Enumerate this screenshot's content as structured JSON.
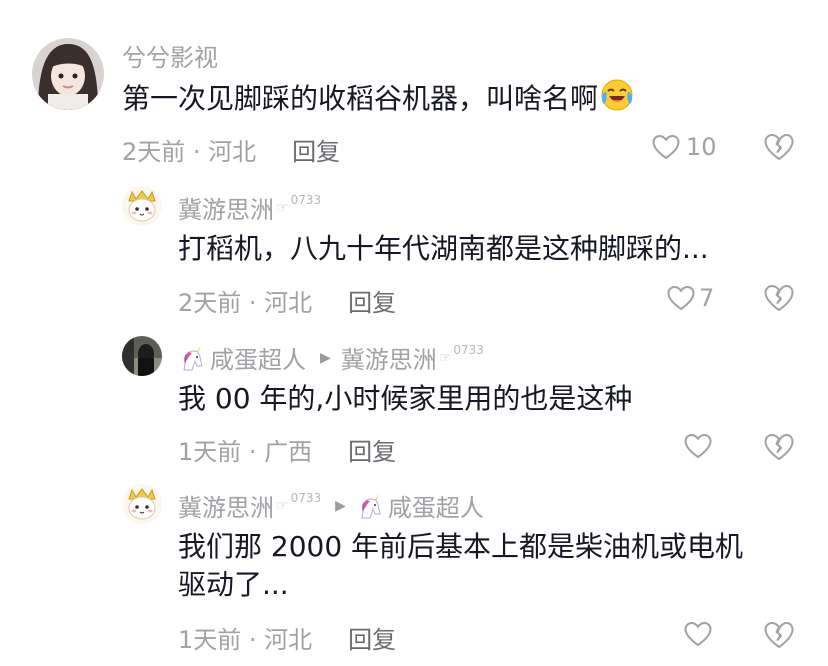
{
  "comments": [
    {
      "username": "兮兮影视",
      "text": "第一次见脚踩的收稻谷机器，叫啥名啊",
      "time_location": "2天前 · 河北",
      "reply_label": "回复",
      "likes": "10"
    },
    {
      "username": "冀游思洲",
      "user_tag": "0733",
      "text": "打稻机，八九十年代湖南都是这种脚踩的...",
      "time_location": "2天前 · 河北",
      "reply_label": "回复",
      "likes": "7"
    },
    {
      "username": "咸蛋超人",
      "reply_to": "冀游思洲",
      "reply_to_tag": "0733",
      "text": "我 00 年的,小时候家里用的也是这种",
      "time_location": "1天前 · 广西",
      "reply_label": "回复",
      "likes": ""
    },
    {
      "username": "冀游思洲",
      "user_tag": "0733",
      "reply_to": "咸蛋超人",
      "text_line1": "我们那 2000 年前后基本上都是柴油机或电机",
      "text_line2": "驱动了...",
      "time_location": "1天前 · 河北",
      "reply_label": "回复",
      "likes": ""
    }
  ],
  "icons": {
    "like": "heart-outline-icon",
    "dislike": "broken-heart-icon",
    "emoji": "laughing-tears-emoji",
    "reply_arrow": "triangle-right-icon",
    "pointing_hand": "pointing-hand-icon"
  },
  "colors": {
    "primary_text": "#161823",
    "secondary_text": "#a1a1a6",
    "reply_label": "#6a6a70"
  }
}
